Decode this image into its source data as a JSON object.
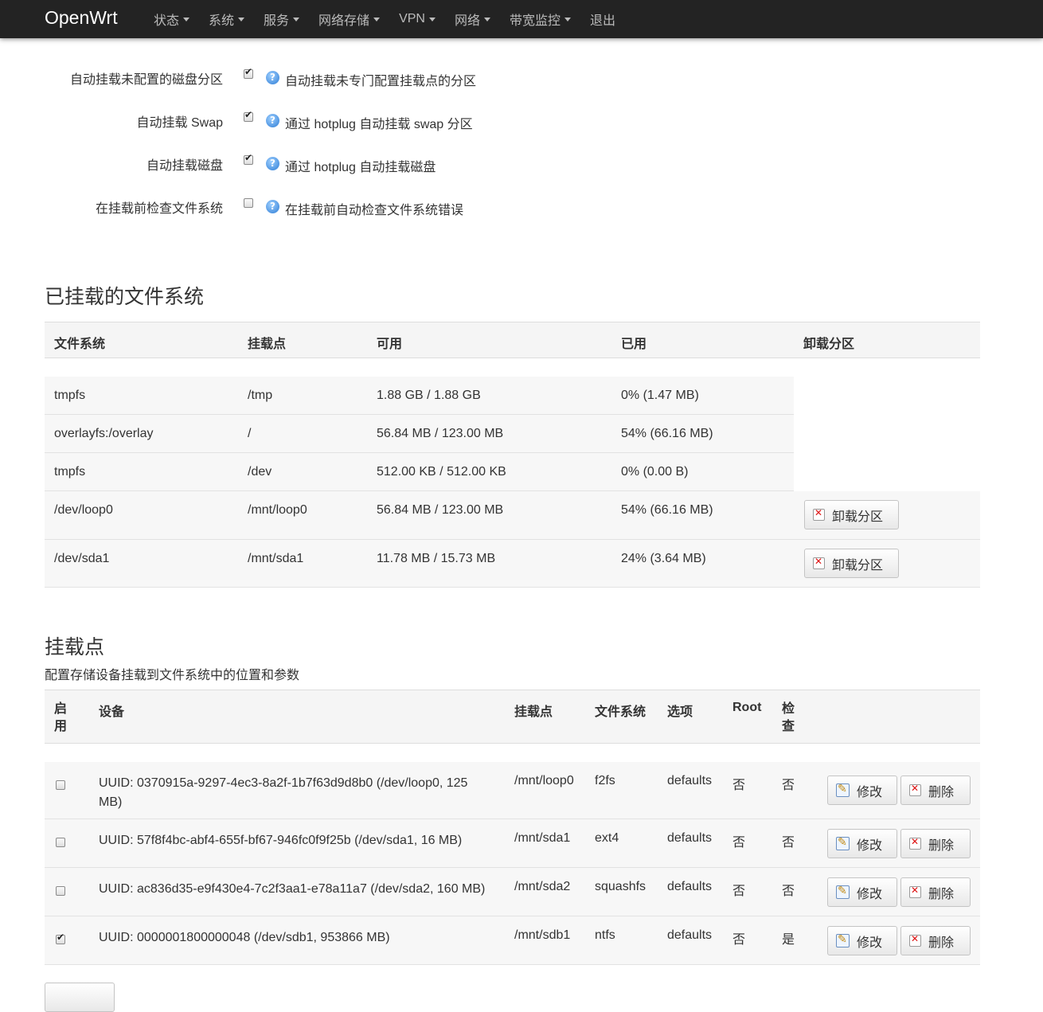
{
  "nav": {
    "brand": "OpenWrt",
    "items": [
      {
        "label": "状态",
        "dropdown": true
      },
      {
        "label": "系统",
        "dropdown": true
      },
      {
        "label": "服务",
        "dropdown": true
      },
      {
        "label": "网络存储",
        "dropdown": true
      },
      {
        "label": "VPN",
        "dropdown": true
      },
      {
        "label": "网络",
        "dropdown": true
      },
      {
        "label": "带宽监控",
        "dropdown": true
      },
      {
        "label": "退出",
        "dropdown": false
      }
    ]
  },
  "global_settings": [
    {
      "label": "自动挂载未配置的磁盘分区",
      "checked": true,
      "help": "自动挂载未专门配置挂载点的分区"
    },
    {
      "label": "自动挂载 Swap",
      "checked": true,
      "help": "通过 hotplug 自动挂载 swap 分区"
    },
    {
      "label": "自动挂载磁盘",
      "checked": true,
      "help": "通过 hotplug 自动挂载磁盘"
    },
    {
      "label": "在挂载前检查文件系统",
      "checked": false,
      "help": "在挂载前自动检查文件系统错误"
    }
  ],
  "mounted": {
    "title": "已挂载的文件系统",
    "headers": [
      "文件系统",
      "挂载点",
      "可用",
      "已用",
      "卸载分区"
    ],
    "rows": [
      {
        "fs": "tmpfs",
        "mount": "/tmp",
        "avail": "1.88 GB / 1.88 GB",
        "used": "0% (1.47 MB)",
        "unmount": null
      },
      {
        "fs": "overlayfs:/overlay",
        "mount": "/",
        "avail": "56.84 MB / 123.00 MB",
        "used": "54% (66.16 MB)",
        "unmount": null
      },
      {
        "fs": "tmpfs",
        "mount": "/dev",
        "avail": "512.00 KB / 512.00 KB",
        "used": "0% (0.00 B)",
        "unmount": null
      },
      {
        "fs": "/dev/loop0",
        "mount": "/mnt/loop0",
        "avail": "56.84 MB / 123.00 MB",
        "used": "54% (66.16 MB)",
        "unmount": "卸载分区"
      },
      {
        "fs": "/dev/sda1",
        "mount": "/mnt/sda1",
        "avail": "11.78 MB / 15.73 MB",
        "used": "24% (3.64 MB)",
        "unmount": "卸载分区"
      }
    ]
  },
  "mountpoints": {
    "title": "挂载点",
    "description": "配置存储设备挂载到文件系统中的位置和参数",
    "headers": {
      "enable": [
        "启",
        "用"
      ],
      "device": "设备",
      "mount": "挂载点",
      "fs": "文件系统",
      "options": "选项",
      "root": "Root",
      "check": [
        "检",
        "查"
      ]
    },
    "edit_label": "修改",
    "delete_label": "删除",
    "rows": [
      {
        "enabled": false,
        "device": [
          "UUID: 0370915a-9297-4ec3-8a2f-1b7f63d9d8b0 (/dev/loop0, 125",
          "MB)"
        ],
        "mount": "/mnt/loop0",
        "fs": "f2fs",
        "options": "defaults",
        "root": "否",
        "check": "否"
      },
      {
        "enabled": false,
        "device": [
          "UUID: 57f8f4bc-abf4-655f-bf67-946fc0f9f25b (/dev/sda1, 16 MB)"
        ],
        "mount": "/mnt/sda1",
        "fs": "ext4",
        "options": "defaults",
        "root": "否",
        "check": "否"
      },
      {
        "enabled": false,
        "device": [
          "UUID: ac836d35-e9f430e4-7c2f3aa1-e78a11a7 (/dev/sda2, 160 MB)"
        ],
        "mount": "/mnt/sda2",
        "fs": "squashfs",
        "options": "defaults",
        "root": "否",
        "check": "否"
      },
      {
        "enabled": true,
        "device": [
          "UUID: 0000001800000048 (/dev/sdb1, 953866 MB)"
        ],
        "mount": "/mnt/sdb1",
        "fs": "ntfs",
        "options": "defaults",
        "root": "否",
        "check": "是"
      }
    ]
  }
}
